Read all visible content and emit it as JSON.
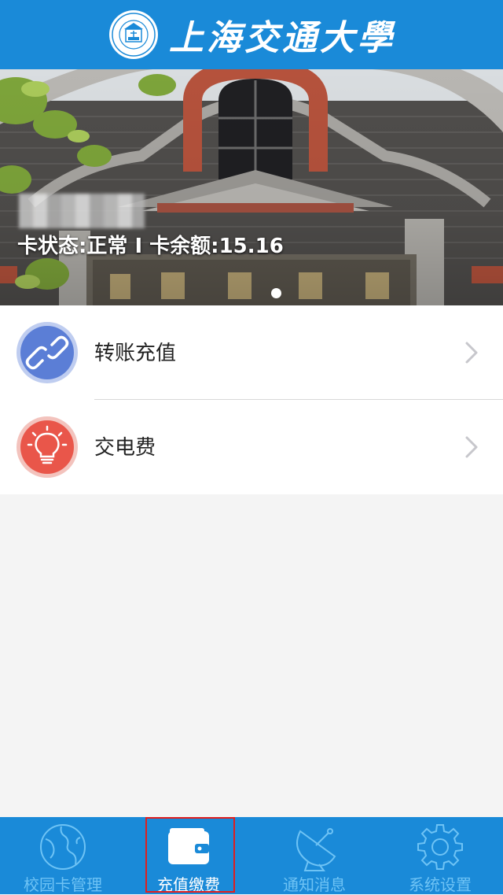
{
  "header": {
    "title": "上海交通大學",
    "logo_icon": "university-emblem-icon"
  },
  "banner": {
    "card_status": "卡状态:正常 I 卡余额:15.16",
    "page_indicator": "1"
  },
  "menu": {
    "items": [
      {
        "label": "转账充值",
        "icon": "link-icon",
        "color": "#5b7ed6"
      },
      {
        "label": "交电费",
        "icon": "lightbulb-icon",
        "color": "#e9564a"
      }
    ]
  },
  "tabbar": {
    "tabs": [
      {
        "label": "校园卡管理",
        "icon": "globe-icon"
      },
      {
        "label": "充值缴费",
        "icon": "wallet-icon",
        "active": true
      },
      {
        "label": "通知消息",
        "icon": "satellite-dish-icon"
      },
      {
        "label": "系统设置",
        "icon": "gear-icon"
      }
    ]
  },
  "colors": {
    "primary": "#1a8ad8",
    "inactive_tab_text": "#6ec3f5",
    "highlight_frame": "#e01e1e"
  }
}
